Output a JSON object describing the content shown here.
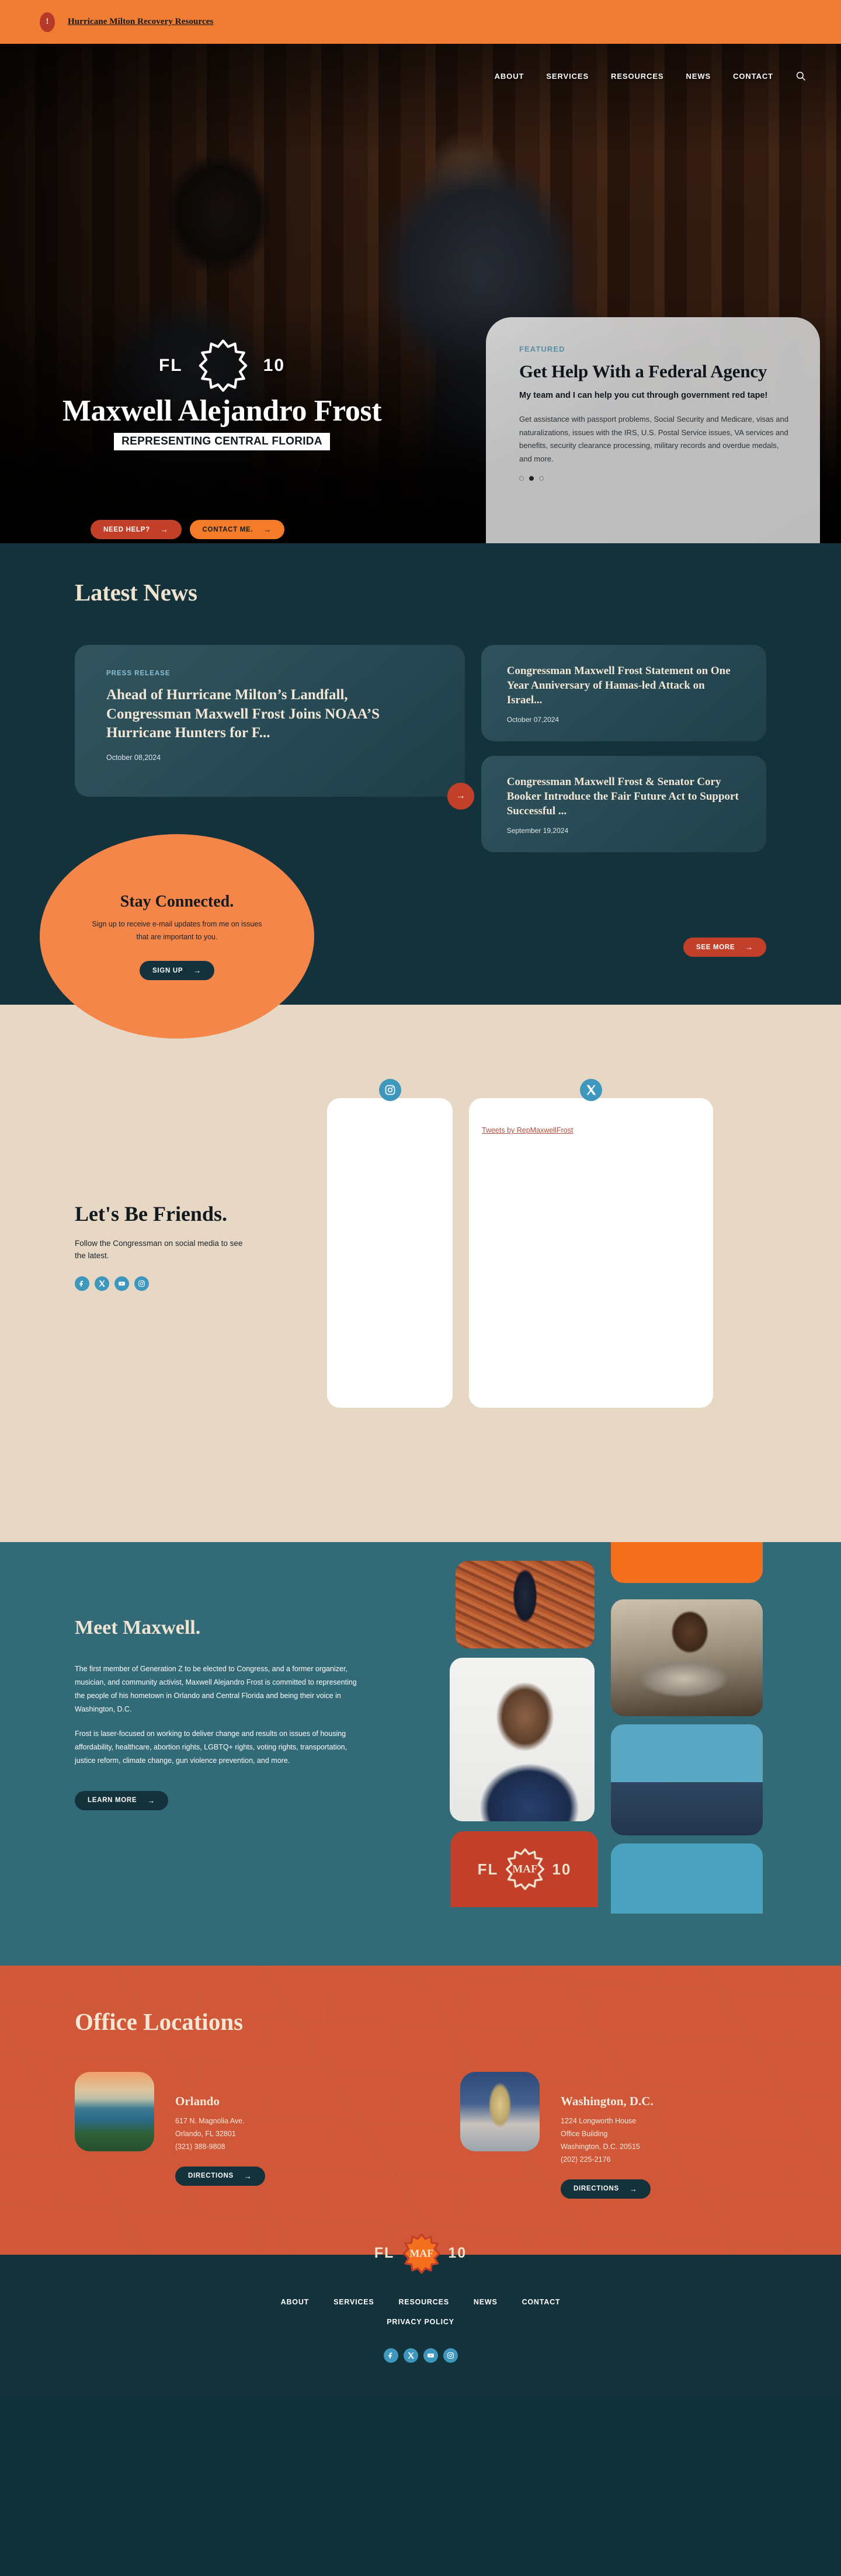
{
  "alert": {
    "icon": "alert-exclamation-icon",
    "text": "Hurricane Milton Recovery Resources"
  },
  "nav": {
    "items": [
      "ABOUT",
      "SERVICES",
      "RESOURCES",
      "NEWS",
      "CONTACT"
    ],
    "search_icon": "search-icon"
  },
  "hero": {
    "badge_left": "FL",
    "badge_right": "10",
    "name": "Maxwell Alejandro Frost",
    "subtitle": "REPRESENTING CENTRAL FLORIDA",
    "btn_primary": "NEED HELP?",
    "btn_secondary": "CONTACT ME.",
    "arrow": "→",
    "featured": {
      "kicker": "FEATURED",
      "title": "Get Help With a Federal Agency",
      "lead": "My team and I can help you cut through government red tape!",
      "body": "Get assistance with passport problems, Social Security and Medicare, visas and naturalizations, issues with the IRS, U.S. Postal Service issues, VA services and benefits, security clearance processing, military records and overdue medals, and more.",
      "slides": 3,
      "active_slide": 2
    }
  },
  "news": {
    "title": "Latest News",
    "featured_card": {
      "kicker": "PRESS RELEASE",
      "headline": "Ahead of Hurricane Milton’s Landfall, Congressman Maxwell Frost Joins NOAA’S Hurricane Hunters for F...",
      "date": "October 08,2024"
    },
    "cards": [
      {
        "headline": "Congressman Maxwell Frost Statement on One Year Anniversary of Hamas-led Attack on Israel...",
        "date": "October 07,2024"
      },
      {
        "headline": "Congressman Maxwell Frost & Senator Cory Booker Introduce the Fair Future Act to Support Successful ...",
        "date": "September 19,2024"
      }
    ],
    "see_more": "SEE MORE",
    "cta": {
      "title": "Stay Connected.",
      "body": "Sign up to receive e-mail updates from me on issues that are important to you.",
      "button": "SIGN UP"
    }
  },
  "social": {
    "heading": "Let's Be Friends.",
    "body": "Follow the Congressman on social media to see the latest.",
    "icons": [
      "facebook-icon",
      "x-twitter-icon",
      "youtube-icon",
      "instagram-icon"
    ],
    "instagram_badge": "instagram-icon",
    "twitter_badge": "x-twitter-icon",
    "tweets_link": "Tweets by RepMaxwellFrost"
  },
  "meet": {
    "heading": "Meet Maxwell.",
    "paragraph1": "The first member of Generation Z to be elected to Congress, and a former organizer, musician, and community activist, Maxwell Alejandro Frost is committed to representing the people of his hometown in Orlando and Central Florida and being their voice in Washington, D.C.",
    "paragraph2": "Frost is laser-focused on working to deliver change and results on issues of housing affordability, healthcare, abortion rights, LGBTQ+ rights, voting rights, transportation, justice reform, climate change, gun violence prevention, and more.",
    "button": "LEARN MORE",
    "logo_left": "FL",
    "logo_center": "MAF",
    "logo_right": "10"
  },
  "offices": {
    "title": "Office Locations",
    "items": [
      {
        "name": "Orlando",
        "address_line1": "617 N. Magnolia Ave.",
        "address_line2": "Orlando, FL 32801",
        "phone": "(321) 388-9808",
        "button": "DIRECTIONS",
        "thumb": "orlando-skyline-photo"
      },
      {
        "name": "Washington, D.C.",
        "address_line1": "1224 Longworth House",
        "address_line2": "Office Building",
        "address_line3": "Washington, D.C. 20515",
        "phone": "(202) 225-2176",
        "button": "DIRECTIONS",
        "thumb": "us-capitol-photo"
      }
    ]
  },
  "footer": {
    "logo_left": "FL",
    "logo_center": "MAF",
    "logo_right": "10",
    "nav": [
      "ABOUT",
      "SERVICES",
      "RESOURCES",
      "NEWS",
      "CONTACT"
    ],
    "privacy": "PRIVACY POLICY",
    "icons": [
      "facebook-icon",
      "x-twitter-icon",
      "youtube-icon",
      "instagram-icon"
    ]
  },
  "colors": {
    "alert_orange": "#F07D33",
    "brand_orange": "#F4701E",
    "brand_red": "#C2402A",
    "teal_dark": "#13323b",
    "teal_mid": "#336A78",
    "beige": "#E7D8C5",
    "cream": "#EFE2CF",
    "social_blue": "#3E97BC",
    "office_red": "#D15739"
  }
}
